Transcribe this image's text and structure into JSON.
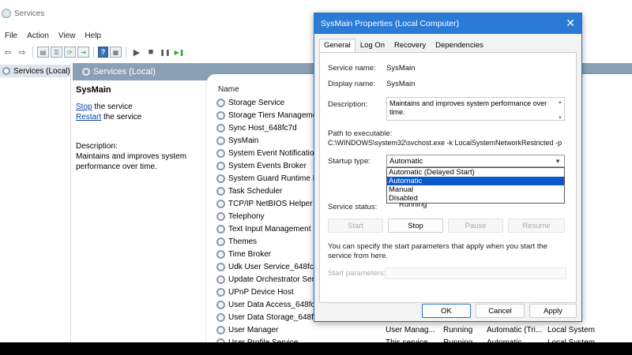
{
  "window": {
    "title": "Services"
  },
  "menu": [
    "File",
    "Action",
    "View",
    "Help"
  ],
  "toolbar": {
    "play": "▶",
    "stop": "■",
    "pause": "❚❚",
    "restart": "▶❚"
  },
  "tree": {
    "root": "Services (Local)"
  },
  "pane": {
    "header": "Services (Local)",
    "selected_service": "SysMain",
    "stop_link": "Stop",
    "stop_rest": " the service",
    "restart_link": "Restart",
    "restart_rest": " the service",
    "description_label": "Description:",
    "description_text": "Maintains and improves system performance over time."
  },
  "list": {
    "column_name": "Name",
    "rows": [
      {
        "name": "Storage Service",
        "desc": "",
        "status": "",
        "startup": "",
        "logon": ""
      },
      {
        "name": "Storage Tiers Manageme",
        "desc": "",
        "status": "",
        "startup": "",
        "logon": ""
      },
      {
        "name": "Sync Host_648fc7d",
        "desc": "",
        "status": "",
        "startup": "",
        "logon": ""
      },
      {
        "name": "SysMain",
        "desc": "",
        "status": "",
        "startup": "",
        "logon": ""
      },
      {
        "name": "System Event Notificatio",
        "desc": "",
        "status": "",
        "startup": "",
        "logon": ""
      },
      {
        "name": "System Events Broker",
        "desc": "",
        "status": "",
        "startup": "",
        "logon": ""
      },
      {
        "name": "System Guard Runtime M",
        "desc": "",
        "status": "",
        "startup": "",
        "logon": ""
      },
      {
        "name": "Task Scheduler",
        "desc": "",
        "status": "",
        "startup": "",
        "logon": ""
      },
      {
        "name": "TCP/IP NetBIOS Helper",
        "desc": "",
        "status": "",
        "startup": "",
        "logon": ""
      },
      {
        "name": "Telephony",
        "desc": "",
        "status": "",
        "startup": "",
        "logon": ""
      },
      {
        "name": "Text Input Management",
        "desc": "",
        "status": "",
        "startup": "",
        "logon": ""
      },
      {
        "name": "Themes",
        "desc": "",
        "status": "",
        "startup": "",
        "logon": ""
      },
      {
        "name": "Time Broker",
        "desc": "",
        "status": "",
        "startup": "",
        "logon": ""
      },
      {
        "name": "Udk User Service_648fc7d",
        "desc": "",
        "status": "",
        "startup": "",
        "logon": ""
      },
      {
        "name": "Update Orchestrator Serv",
        "desc": "",
        "status": "",
        "startup": "",
        "logon": ""
      },
      {
        "name": "UPnP Device Host",
        "desc": "",
        "status": "",
        "startup": "",
        "logon": ""
      },
      {
        "name": "User Data Access_648fc7d",
        "desc": "",
        "status": "",
        "startup": "",
        "logon": ""
      },
      {
        "name": "User Data Storage_648fc7d",
        "desc": "",
        "status": "",
        "startup": "",
        "logon": ""
      },
      {
        "name": "User Manager",
        "desc": "User Manag...",
        "status": "Running",
        "startup": "Automatic (Tri...",
        "logon": "Local System"
      },
      {
        "name": "User Profile Service",
        "desc": "This service...",
        "status": "Running",
        "startup": "Automatic",
        "logon": "Local System"
      }
    ]
  },
  "dialog": {
    "title": "SysMain Properties (Local Computer)",
    "close": "✕",
    "tabs": [
      "General",
      "Log On",
      "Recovery",
      "Dependencies"
    ],
    "service_name_label": "Service name:",
    "service_name": "SysMain",
    "display_name_label": "Display name:",
    "display_name": "SysMain",
    "description_label": "Description:",
    "description": "Maintains and improves system performance over time.",
    "path_label": "Path to executable:",
    "path": "C:\\WINDOWS\\system32\\svchost.exe -k LocalSystemNetworkRestricted -p",
    "startup_label": "Startup type:",
    "startup_value": "Automatic",
    "startup_options": [
      "Automatic (Delayed Start)",
      "Automatic",
      "Manual",
      "Disabled"
    ],
    "status_label": "Service status:",
    "status_value": "Running",
    "buttons": {
      "start": "Start",
      "stop": "Stop",
      "pause": "Pause",
      "resume": "Resume"
    },
    "note": "You can specify the start parameters that apply when you start the service from here.",
    "params_label": "Start parameters:",
    "ok": "OK",
    "cancel": "Cancel",
    "apply": "Apply"
  }
}
